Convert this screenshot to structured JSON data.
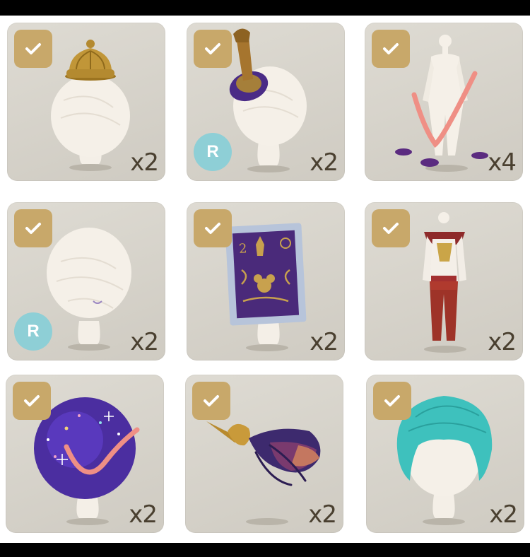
{
  "items": [
    {
      "id": "crown-hat",
      "count": "x2",
      "badge": ""
    },
    {
      "id": "purple-topper-hat",
      "count": "x2",
      "badge": "R"
    },
    {
      "id": "white-bodysuit-outfit",
      "count": "x4",
      "badge": ""
    },
    {
      "id": "plain-head",
      "count": "x2",
      "badge": "R"
    },
    {
      "id": "stamp-card-accessory",
      "count": "x2",
      "badge": ""
    },
    {
      "id": "red-sailor-outfit",
      "count": "x2",
      "badge": ""
    },
    {
      "id": "galaxy-afro-hair",
      "count": "x2",
      "badge": ""
    },
    {
      "id": "feather-quill-accessory",
      "count": "x2",
      "badge": ""
    },
    {
      "id": "teal-hair",
      "count": "x2",
      "badge": ""
    }
  ],
  "colors": {
    "check_bg": "#c8a86a",
    "r_badge": "#8ecfd6",
    "count_text": "#4a4030",
    "card_bg": "#d8d4cc"
  },
  "icons": {
    "check": "check-icon",
    "rarity": "r-badge"
  }
}
